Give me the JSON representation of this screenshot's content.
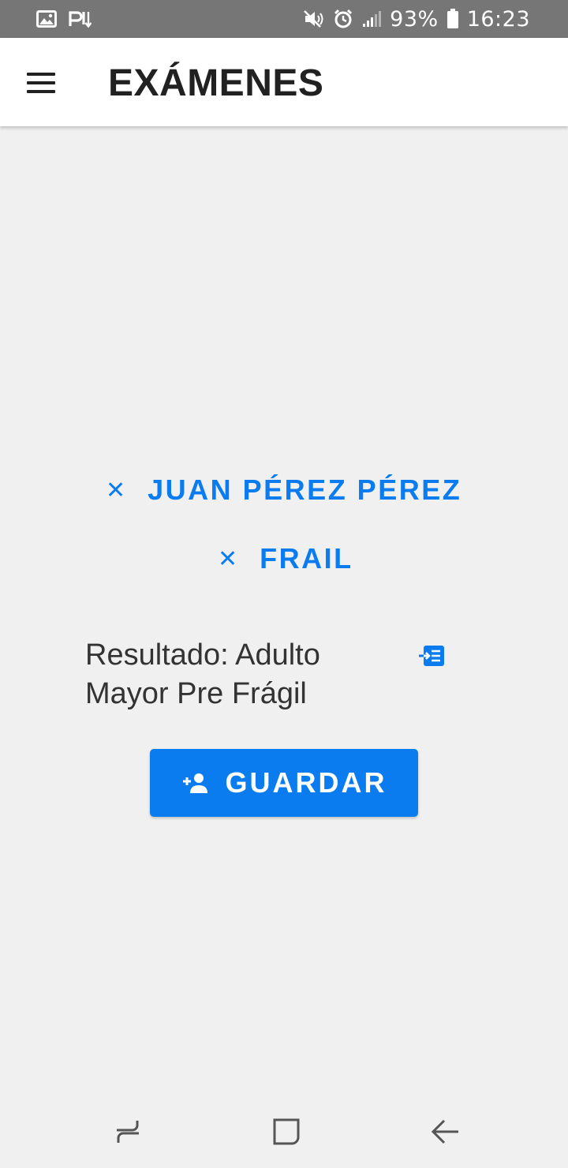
{
  "status_bar": {
    "battery": "93%",
    "time": "16:23",
    "icons": [
      "gallery-icon",
      "download-icon",
      "mute-icon",
      "alarm-icon",
      "signal-icon",
      "battery-icon"
    ]
  },
  "app_bar": {
    "title": "EXÁMENES",
    "menu_icon": "menu-icon"
  },
  "main": {
    "patient_chip": {
      "label": "JUAN PÉREZ PÉREZ",
      "icon": "close-icon",
      "icon_glyph": "✕"
    },
    "test_chip": {
      "label": "FRAIL",
      "icon": "close-icon",
      "icon_glyph": "✕"
    },
    "result": {
      "text": "Resultado: Adulto Mayor Pre Frágil",
      "icon": "import-list-icon"
    },
    "save_button": {
      "label": "GUARDAR",
      "icon": "add-person-icon"
    }
  },
  "nav_bar": {
    "recents": "recents-icon",
    "home": "home-icon",
    "back": "back-icon"
  },
  "colors": {
    "accent": "#0a7cf0",
    "status_bar": "#767676",
    "background": "#f0f0f0",
    "app_bar": "#ffffff",
    "text_dark": "#212121"
  }
}
